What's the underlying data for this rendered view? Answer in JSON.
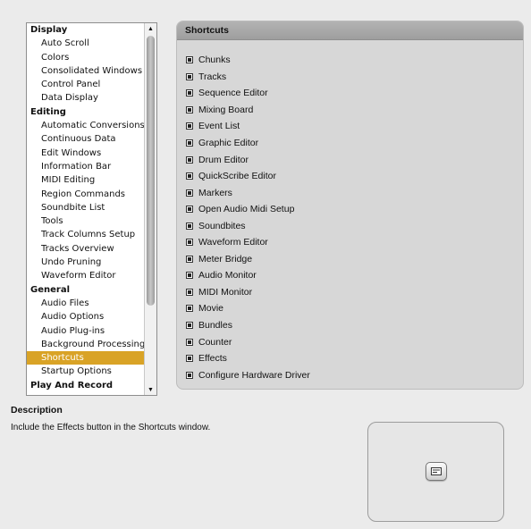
{
  "sidebar": {
    "groups": [
      {
        "label": "Display",
        "items": [
          "Auto Scroll",
          "Colors",
          "Consolidated Windows",
          "Control Panel",
          "Data Display"
        ]
      },
      {
        "label": "Editing",
        "items": [
          "Automatic Conversions",
          "Continuous Data",
          "Edit Windows",
          "Information Bar",
          "MIDI Editing",
          "Region Commands",
          "Soundbite List",
          "Tools",
          "Track Columns Setup",
          "Tracks Overview",
          "Undo Pruning",
          "Waveform Editor"
        ]
      },
      {
        "label": "General",
        "items": [
          "Audio Files",
          "Audio Options",
          "Audio Plug-ins",
          "Background Processing",
          "Shortcuts",
          "Startup Options"
        ]
      },
      {
        "label": "Play And Record",
        "items": []
      }
    ],
    "selected": "Shortcuts",
    "scroll_up_icon": "triangle-up-icon",
    "scroll_down_icon": "triangle-down-icon"
  },
  "panel": {
    "title": "Shortcuts",
    "checkboxes": [
      {
        "label": "Chunks",
        "checked": true
      },
      {
        "label": "Tracks",
        "checked": true
      },
      {
        "label": "Sequence Editor",
        "checked": true
      },
      {
        "label": "Mixing Board",
        "checked": true
      },
      {
        "label": "Event List",
        "checked": true
      },
      {
        "label": "Graphic Editor",
        "checked": true
      },
      {
        "label": "Drum Editor",
        "checked": true
      },
      {
        "label": "QuickScribe Editor",
        "checked": true
      },
      {
        "label": "Markers",
        "checked": true
      },
      {
        "label": "Open Audio Midi Setup",
        "checked": true
      },
      {
        "label": "Soundbites",
        "checked": true
      },
      {
        "label": "Waveform Editor",
        "checked": true
      },
      {
        "label": "Meter Bridge",
        "checked": true
      },
      {
        "label": "Audio Monitor",
        "checked": true
      },
      {
        "label": "MIDI Monitor",
        "checked": true
      },
      {
        "label": "Movie",
        "checked": true
      },
      {
        "label": "Bundles",
        "checked": true
      },
      {
        "label": "Counter",
        "checked": true
      },
      {
        "label": "Effects",
        "checked": true
      },
      {
        "label": "Configure Hardware Driver",
        "checked": true
      }
    ]
  },
  "description": {
    "title": "Description",
    "text": "Include the Effects button in the Shortcuts window.",
    "preview_icon": "effects-button-icon"
  },
  "colors": {
    "selection": "#d9a326",
    "background": "#ebebeb",
    "panel": "#d7d7d7"
  }
}
